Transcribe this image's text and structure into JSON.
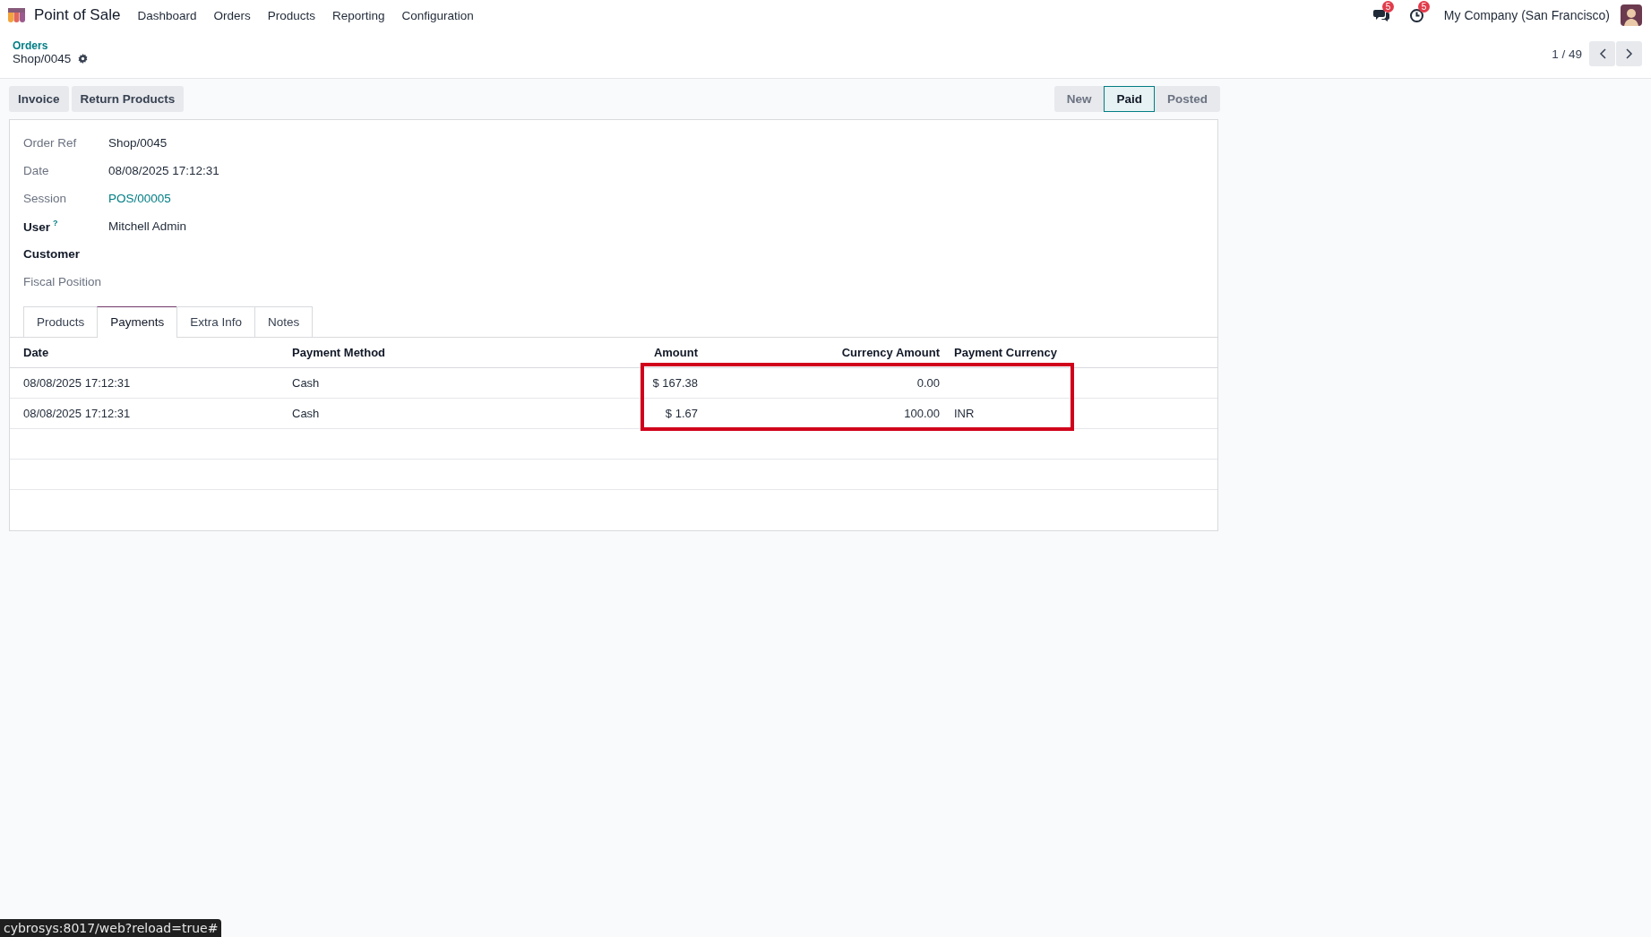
{
  "navbar": {
    "app_name": "Point of Sale",
    "menu": [
      "Dashboard",
      "Orders",
      "Products",
      "Reporting",
      "Configuration"
    ],
    "messages_badge": "5",
    "activities_badge": "5",
    "company": "My Company (San Francisco)"
  },
  "breadcrumb": {
    "parent": "Orders",
    "current": "Shop/0045"
  },
  "pager": {
    "text": "1 / 49"
  },
  "actions": [
    "Invoice",
    "Return Products"
  ],
  "status": [
    {
      "label": "New",
      "selected": false
    },
    {
      "label": "Paid",
      "selected": true
    },
    {
      "label": "Posted",
      "selected": false
    }
  ],
  "fields": [
    {
      "label": "Order Ref",
      "value": "Shop/0045",
      "kind": "text",
      "required": false
    },
    {
      "label": "Date",
      "value": "08/08/2025 17:12:31",
      "kind": "text",
      "required": false
    },
    {
      "label": "Session",
      "value": "POS/00005",
      "kind": "link",
      "required": false
    },
    {
      "label": "User",
      "help": "?",
      "value": "Mitchell Admin",
      "kind": "text",
      "required": true
    },
    {
      "label": "Customer",
      "required": true
    },
    {
      "label": "Fiscal Position",
      "required": false
    }
  ],
  "tabs": [
    {
      "label": "Products",
      "selected": false
    },
    {
      "label": "Payments",
      "selected": true
    },
    {
      "label": "Extra Info",
      "selected": false
    },
    {
      "label": "Notes",
      "selected": false
    }
  ],
  "table": {
    "columns": [
      "Date",
      "Payment Method",
      "Amount",
      "Currency Amount",
      "Payment Currency"
    ],
    "rows": [
      [
        "08/08/2025 17:12:31",
        "Cash",
        "$ 167.38",
        "0.00",
        ""
      ],
      [
        "08/08/2025 17:12:31",
        "Cash",
        "$ 1.67",
        "100.00",
        "INR"
      ]
    ]
  },
  "browser_status": "cybrosys:8017/web?reload=true#"
}
